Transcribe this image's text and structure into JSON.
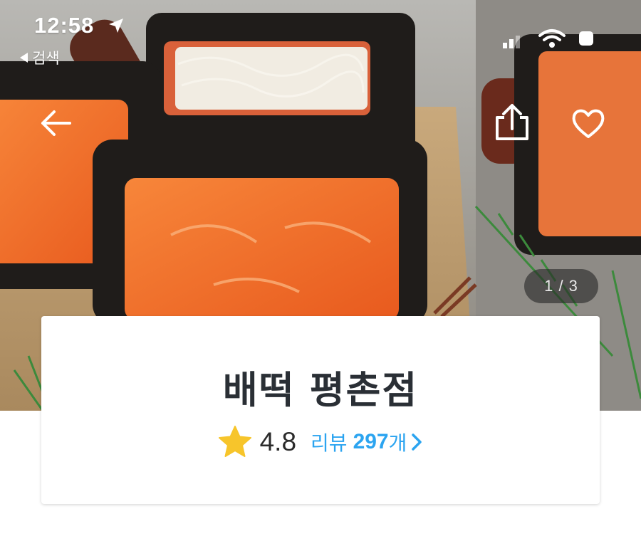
{
  "status_bar": {
    "time": "12:58",
    "back_app": "검색"
  },
  "hero": {
    "page_counter": "1 / 3",
    "icons": [
      "location-arrow-icon",
      "signal-icon",
      "wifi-icon",
      "battery-icon",
      "arrow-left-icon",
      "share-icon",
      "heart-icon"
    ]
  },
  "store": {
    "name": "배떡 평촌점",
    "rating": "4.8",
    "review_label": "리뷰",
    "review_count": "297",
    "review_unit": "개"
  },
  "colors": {
    "accent": "#2ba4f0",
    "star": "#f7c52b",
    "title": "#2a2f35"
  }
}
